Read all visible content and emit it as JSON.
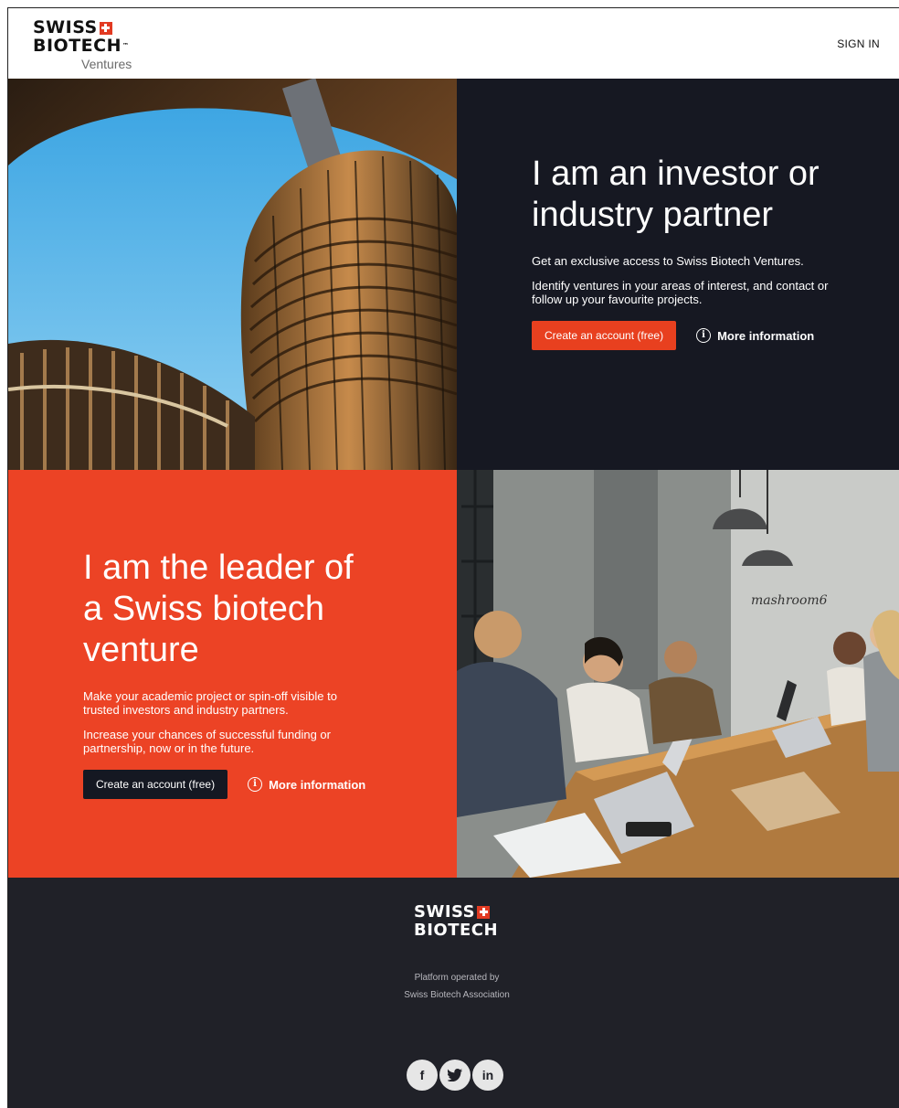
{
  "header": {
    "logo": {
      "line1": "SWISS",
      "line2": "BIOTECH",
      "tm": "™",
      "sub": "Ventures"
    },
    "signin_label": "SIGN IN"
  },
  "investor": {
    "title": "I am an investor or industry partner",
    "text1": "Get an exclusive access to Swiss Biotech Ventures.",
    "text2": "Identify ventures in your areas of interest, and contact or follow up your favourite projects.",
    "cta_label": "Create an account (free)",
    "more_label": "More information"
  },
  "leader": {
    "title": "I am the leader of a Swiss biotech venture",
    "text1": "Make your academic project or spin-off visible to trusted investors and industry partners.",
    "text2": "Increase your chances of successful funding or partnership, now or in the future.",
    "cta_label": "Create an account (free)",
    "more_label": "More information"
  },
  "meeting": {
    "wall_sign": "mashroom6"
  },
  "footer": {
    "logo": {
      "line1": "SWISS",
      "line2": "BIOTECH"
    },
    "operated_by": "Platform operated by",
    "association": "Swiss Biotech Association",
    "socials": [
      {
        "icon": "facebook-icon",
        "glyph": "f"
      },
      {
        "icon": "twitter-icon",
        "glyph": "t"
      },
      {
        "icon": "linkedin-icon",
        "glyph": "in"
      }
    ]
  },
  "colors": {
    "brand_red": "#ec4325",
    "button_red": "#e8401f",
    "dark_navy": "#161822",
    "footer_bg": "#202128"
  }
}
